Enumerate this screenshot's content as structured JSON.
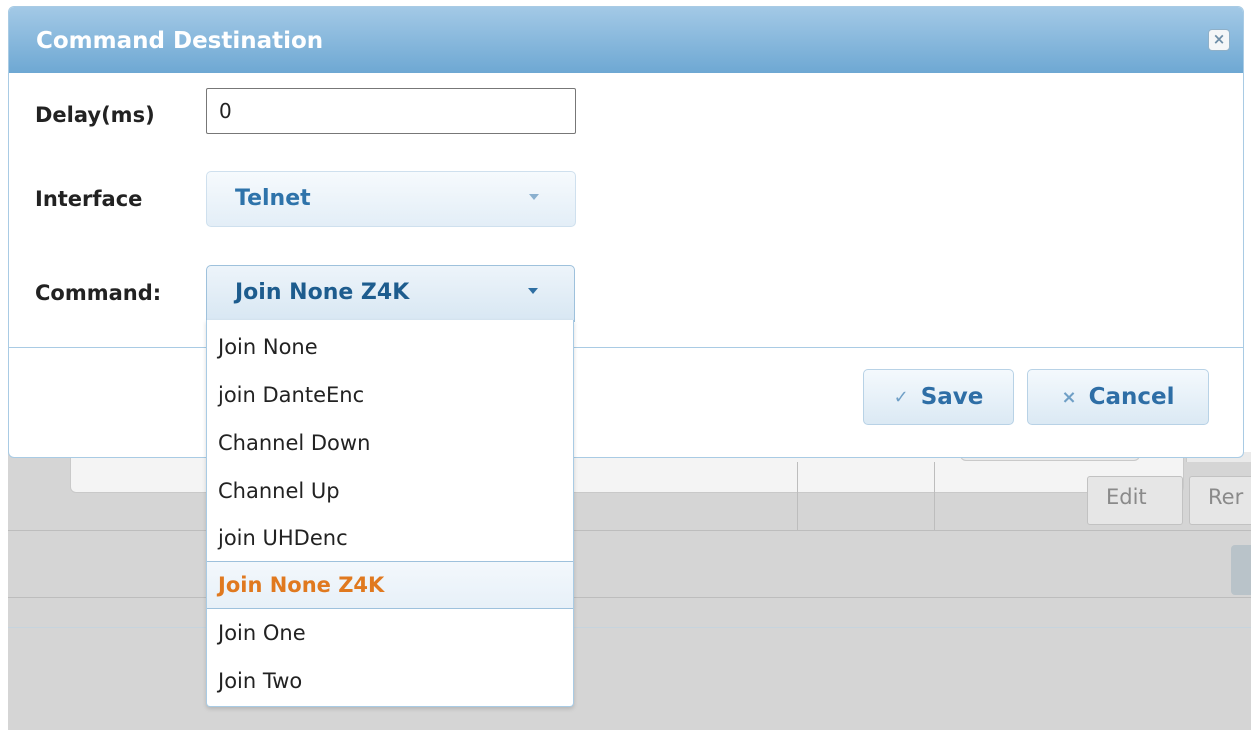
{
  "dialog": {
    "title": "Command Destination",
    "close_icon": "close-icon"
  },
  "form": {
    "delay_label": "Delay(ms)",
    "delay_value": "0",
    "interface_label": "Interface",
    "interface_value": "Telnet",
    "command_label": "Command:",
    "command_value": "Join None Z4K"
  },
  "command_options": [
    "Join None",
    "join DanteEnc",
    "Channel Down",
    "Channel Up",
    "join UHDenc",
    "Join None Z4K",
    "Join One",
    "Join Two"
  ],
  "selected_option": "Join None Z4K",
  "buttons": {
    "save_label": "Save",
    "save_icon": "✓",
    "cancel_label": "Cancel",
    "cancel_icon": "×"
  },
  "background": {
    "edit_label": "Edit",
    "remove_label": "Rer"
  },
  "colors": {
    "title_bar": "#6ea8d3",
    "selected_option_text": "#e0791f",
    "accent_text": "#2e6ea6"
  }
}
